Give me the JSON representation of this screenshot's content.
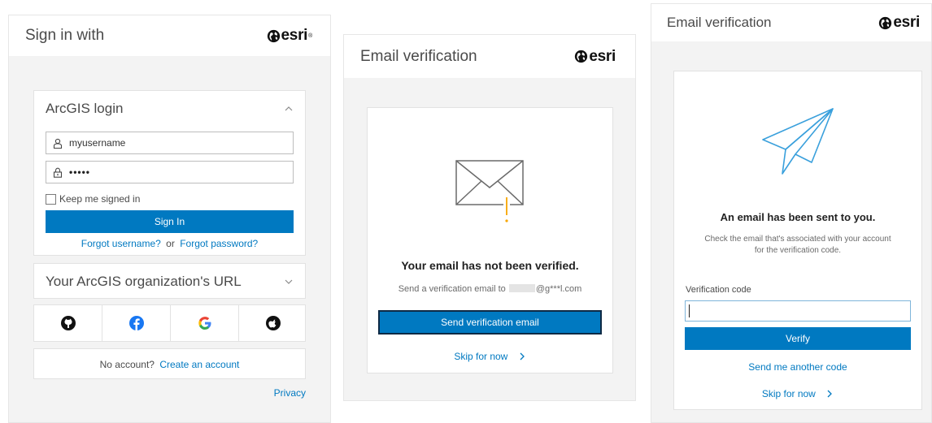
{
  "brand": {
    "logo_text": "esri",
    "tm": "®"
  },
  "signin": {
    "header_title": "Sign in with",
    "arcgis_login": {
      "title": "ArcGIS login",
      "username_value": "myusername",
      "password_value": "•••••",
      "keep_signed_in_label": "Keep me signed in",
      "sign_in_button": "Sign In",
      "forgot_username": "Forgot username?",
      "or_text": "or",
      "forgot_password": "Forgot password?"
    },
    "org_url": {
      "title": "Your ArcGIS organization's URL"
    },
    "social_providers": [
      "github-icon",
      "facebook-icon",
      "google-icon",
      "apple-icon"
    ],
    "no_account_text": "No account?",
    "create_account_link": "Create an account",
    "privacy_link": "Privacy"
  },
  "email_not_verified": {
    "header_title": "Email verification",
    "heading": "Your email has not been verified.",
    "send_to_text": "Send a verification email to",
    "masked_email": "@g***l.com",
    "send_button": "Send verification email",
    "skip_link": "Skip for now"
  },
  "email_sent": {
    "header_title": "Email verification",
    "heading": "An email has been sent to you.",
    "description_line1": "Check the email that's associated with your account",
    "description_line2": "for the verification code.",
    "code_label": "Verification code",
    "code_value": "",
    "verify_button": "Verify",
    "resend_link": "Send me another code",
    "skip_link": "Skip for now"
  },
  "colors": {
    "primary": "#0079c1",
    "panel_bg": "#f3f3f3",
    "alert": "#f7a600"
  }
}
